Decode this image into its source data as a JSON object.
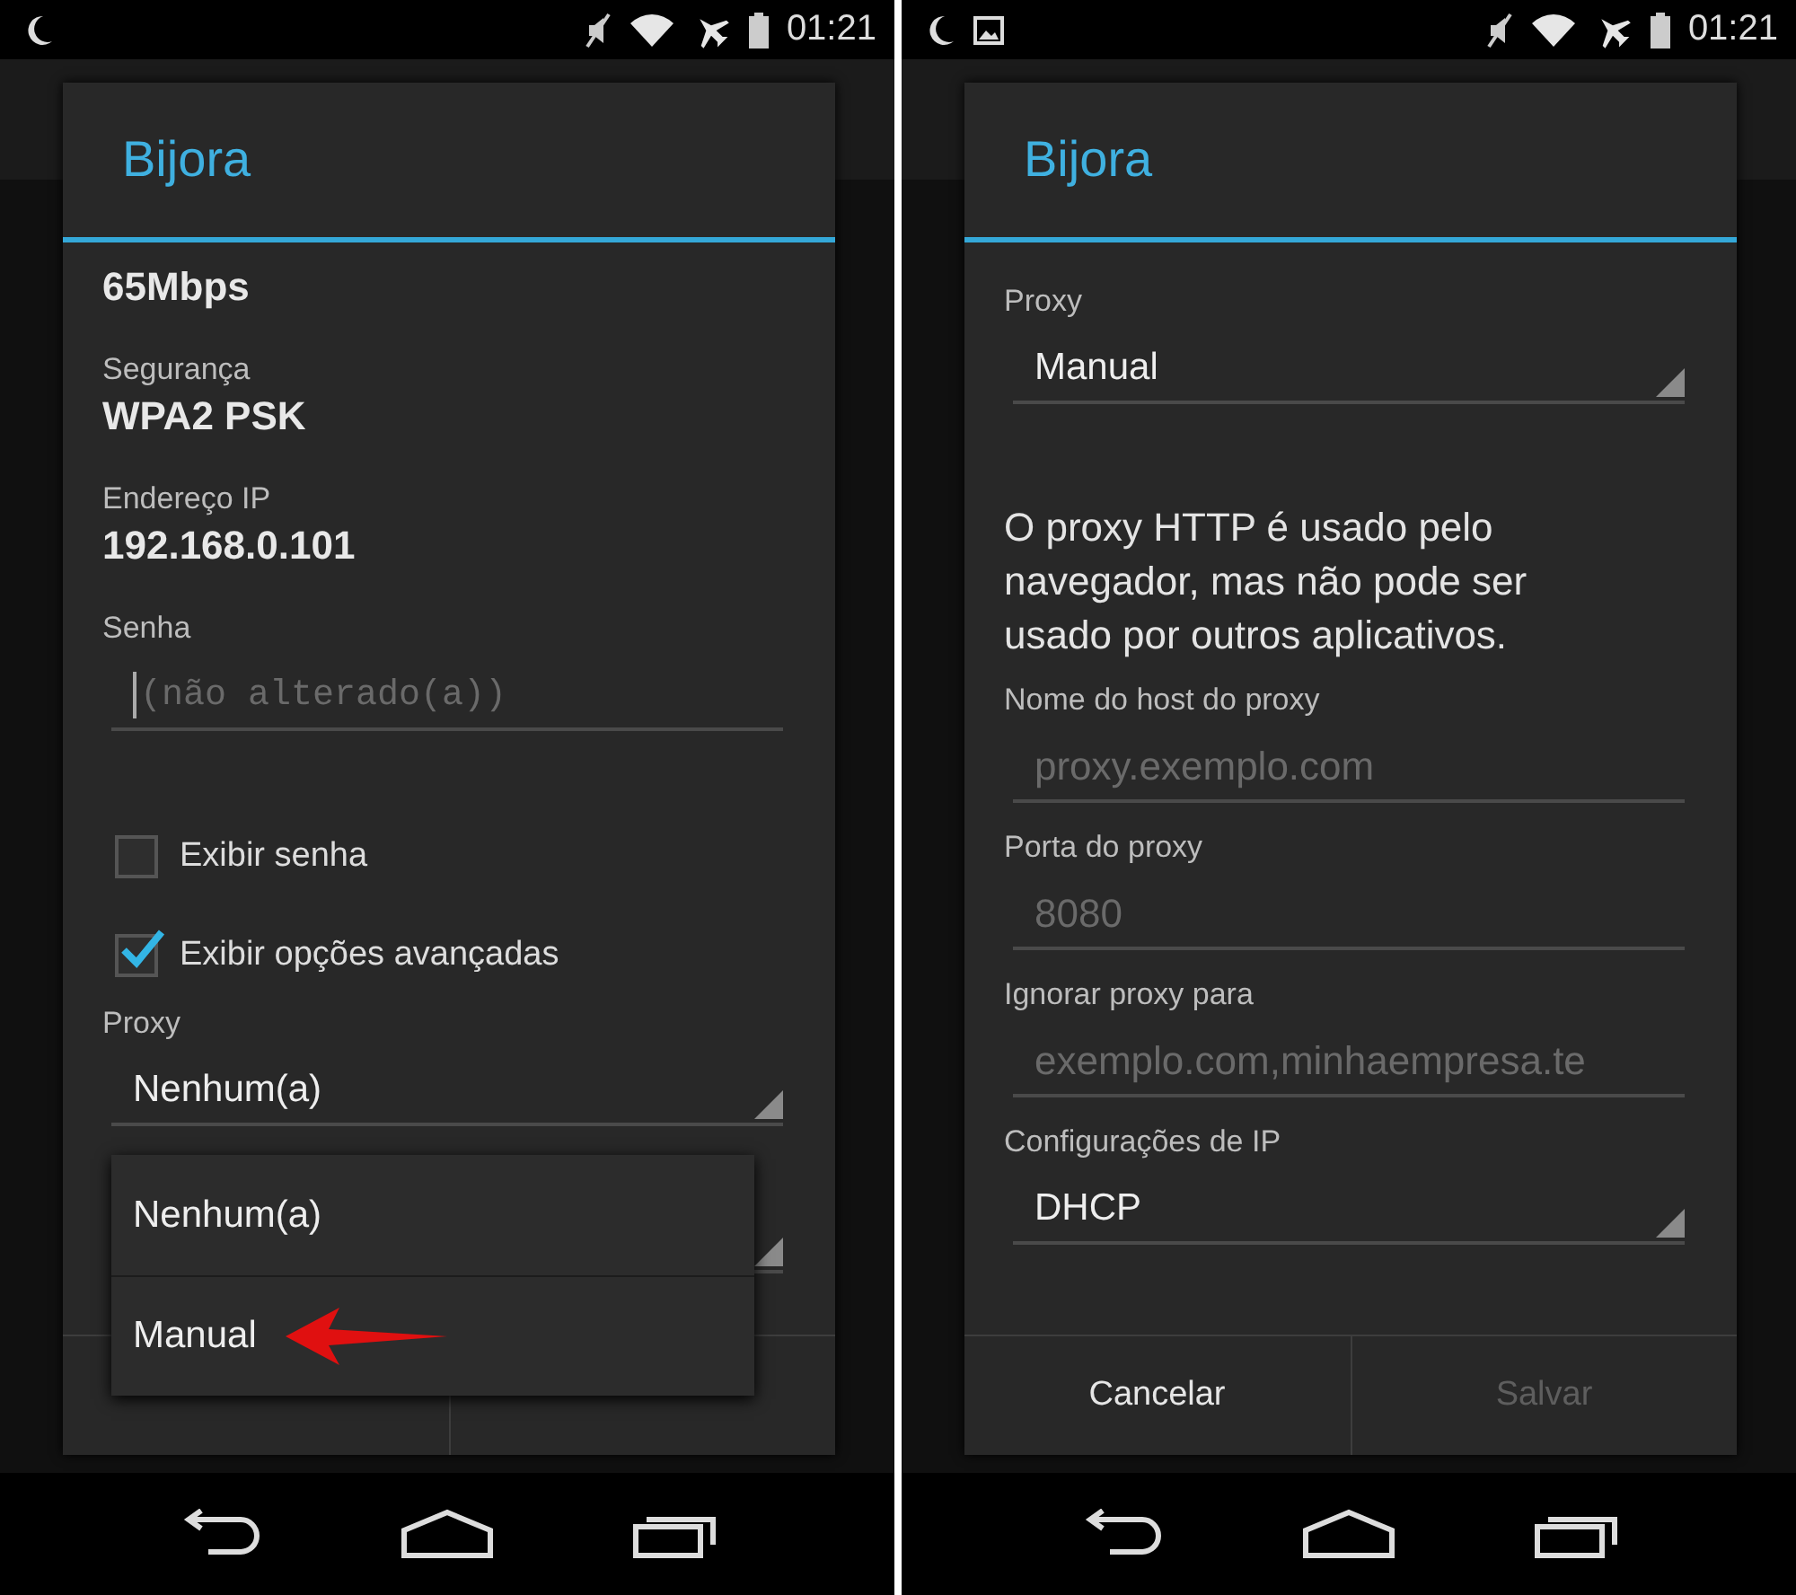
{
  "phones": [
    {
      "status_bar": {
        "notifications": [
          {
            "kind": "moon"
          }
        ],
        "time": "01:21"
      },
      "dialog": {
        "title": "Bijora",
        "items": [
          {
            "kind": "info",
            "value": "65Mbps"
          },
          {
            "kind": "info",
            "label": "Segurança",
            "value": "WPA2 PSK"
          },
          {
            "kind": "info",
            "label": "Endereço IP",
            "value": "192.168.0.101"
          },
          {
            "kind": "password",
            "label": "Senha",
            "placeholder": "(não alterado(a))"
          },
          {
            "kind": "checkbox",
            "label": "Exibir senha",
            "checked": false
          },
          {
            "kind": "checkbox",
            "label": "Exibir opções avançadas",
            "checked": true
          },
          {
            "kind": "spinner",
            "label": "Proxy",
            "value": "Nenhum(a)"
          },
          {
            "kind": "spinner"
          }
        ],
        "dropdown": {
          "options": [
            {
              "label": "Nenhum(a)",
              "pointed": false
            },
            {
              "label": "Manual",
              "pointed": true
            }
          ]
        }
      }
    },
    {
      "status_bar": {
        "notifications": [
          {
            "kind": "moon"
          },
          {
            "kind": "picture"
          }
        ],
        "time": "01:21"
      },
      "dialog": {
        "title": "Bijora",
        "items": [
          {
            "kind": "spinner",
            "label": "Proxy",
            "value": "Manual"
          },
          {
            "kind": "note",
            "text": "O proxy HTTP é usado pelo navegador, mas não pode ser usado por outros aplicativos."
          },
          {
            "kind": "field",
            "label": "Nome do host do proxy",
            "placeholder": "proxy.exemplo.com"
          },
          {
            "kind": "field",
            "label": "Porta do proxy",
            "placeholder": "8080"
          },
          {
            "kind": "field",
            "label": "Ignorar proxy para",
            "placeholder": "exemplo.com,minhaempresa.te"
          },
          {
            "kind": "spinner",
            "label": "Configurações de IP",
            "value": "DHCP"
          }
        ],
        "buttons": [
          {
            "label": "Cancelar",
            "disabled": false
          },
          {
            "label": "Salvar",
            "disabled": true
          }
        ]
      }
    }
  ]
}
